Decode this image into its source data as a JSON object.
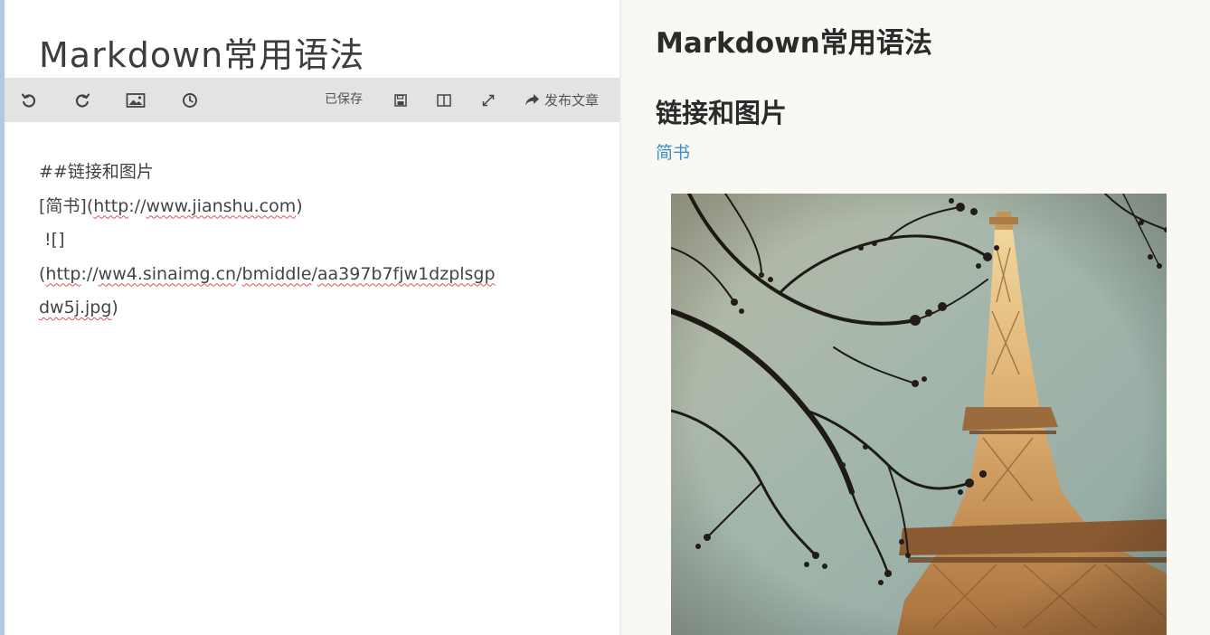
{
  "editor": {
    "title": "Markdown常用语法",
    "toolbar": {
      "undo_icon": "undo-icon",
      "redo_icon": "redo-icon",
      "image_icon": "image-icon",
      "history_icon": "clock-icon",
      "saved_label": "已保存",
      "save_icon": "save-icon",
      "split_icon": "split-view-icon",
      "fullscreen_icon": "expand-icon",
      "publish_label": "发布文章",
      "publish_icon": "share-arrow-icon"
    },
    "content": {
      "line1": "##链接和图片",
      "line2_prefix": "[简书](",
      "line2_url_a": "http",
      "line2_url_b": "://",
      "line2_url_c": "www.jianshu.com",
      "line2_suffix": ")",
      "line3": " ![]",
      "line4_prefix": "(",
      "line4_url_a": "http",
      "line4_url_b": "://",
      "line4_url_c": "ww4.sinaimg.cn",
      "line4_url_d": "/",
      "line4_url_e": "bmiddle",
      "line4_url_f": "/",
      "line4_url_g": "aa397b7fjw1dzplsgp",
      "line5_url": "dw5j.jpg",
      "line5_suffix": ")"
    }
  },
  "preview": {
    "title": "Markdown常用语法",
    "heading": "链接和图片",
    "link_text": "简书",
    "link_color": "#3b8fc9",
    "image_subject": "eiffel-tower-photo"
  }
}
